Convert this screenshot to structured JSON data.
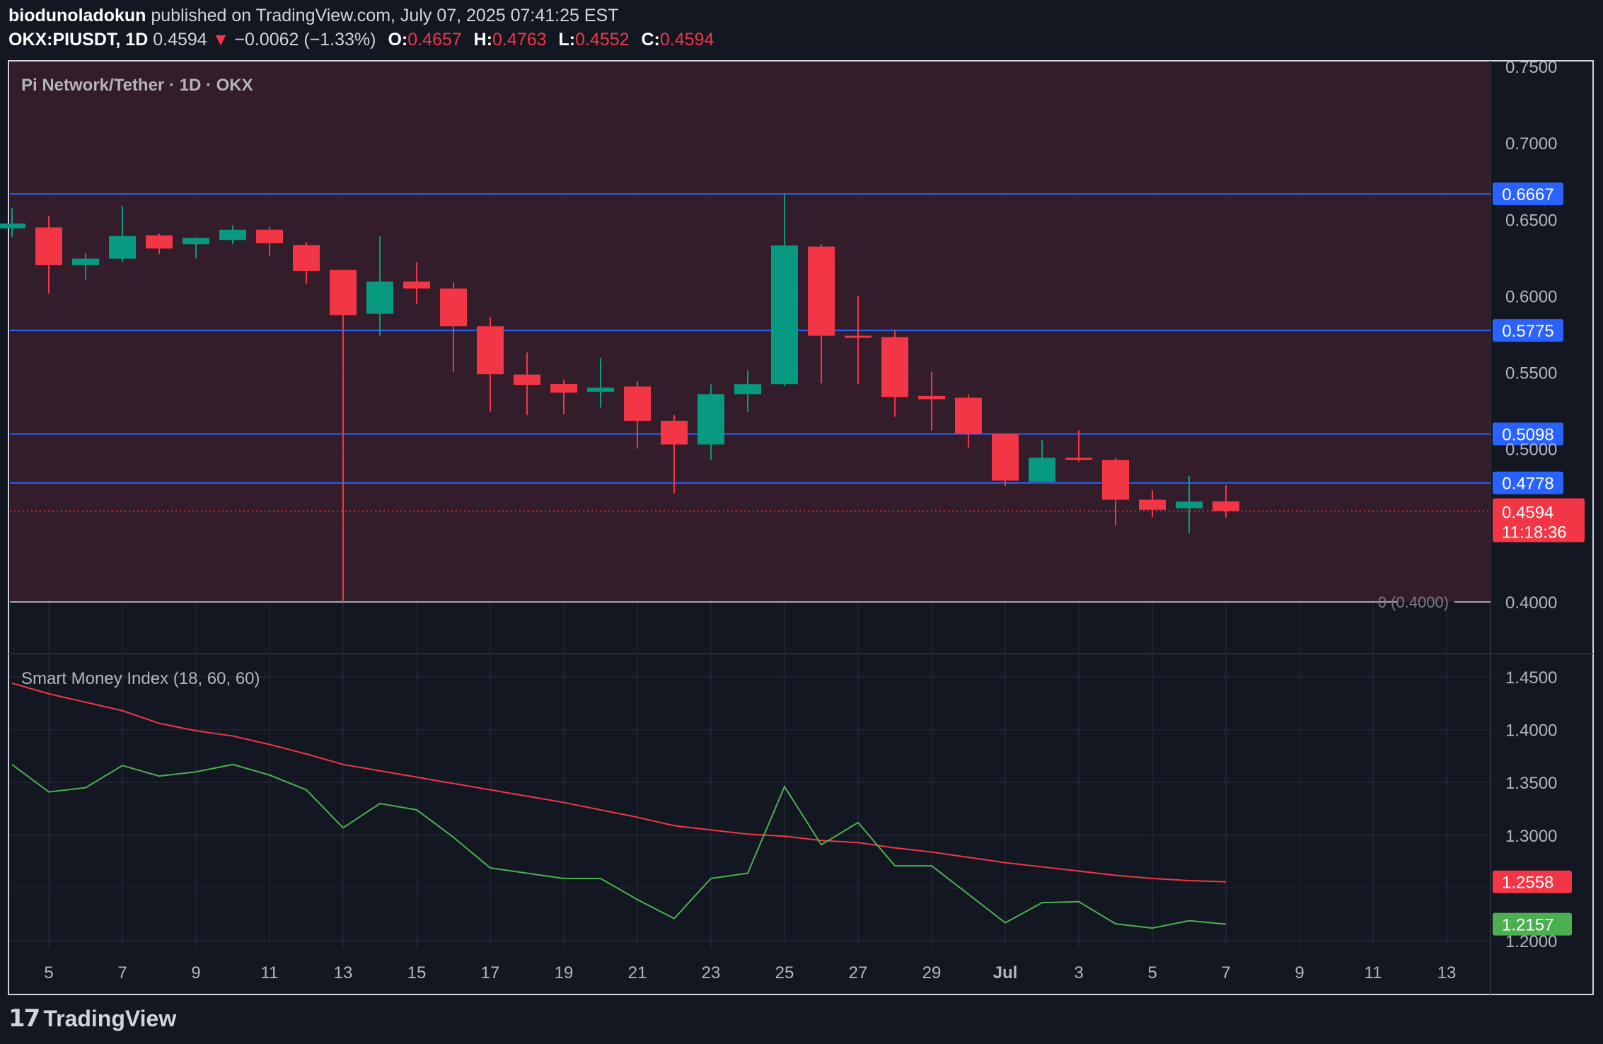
{
  "header": {
    "author": "biodunoladokun",
    "published_text": "published on TradingView.com, July 07, 2025 07:41:25 EST",
    "symbol": "OKX:PIUSDT, 1D",
    "last": "0.4594",
    "change_arrow": "▼",
    "change": "−0.0062 (−1.33%)",
    "open_label": "O:",
    "open": "0.4657",
    "high_label": "H:",
    "high": "0.4763",
    "low_label": "L:",
    "low": "0.4552",
    "close_label": "C:",
    "close": "0.4594"
  },
  "chart_data": [
    {
      "type": "candlestick",
      "title": "Pi Network/Tether · 1D · OKX",
      "ylim": [
        0.4,
        0.75
      ],
      "y_ticks": [
        "0.7500",
        "0.7000",
        "0.6500",
        "0.6000",
        "0.5500",
        "0.5000",
        "0.4000"
      ],
      "x_ticks": [
        "5",
        "7",
        "9",
        "11",
        "13",
        "15",
        "17",
        "19",
        "21",
        "23",
        "25",
        "27",
        "29",
        "Jul",
        "3",
        "5",
        "7",
        "9",
        "11",
        "13"
      ],
      "horizontal_levels": [
        {
          "value": 0.6667,
          "label": "0.6667"
        },
        {
          "value": 0.5775,
          "label": "0.5775"
        },
        {
          "value": 0.5098,
          "label": "0.5098"
        },
        {
          "value": 0.4778,
          "label": "0.4778"
        }
      ],
      "base_level": {
        "value": 0.4,
        "label": "0 (0.4000)"
      },
      "last_price_label": "0.4594",
      "countdown_label": "11:18:36",
      "candles": [
        {
          "date": "Jun 4",
          "open": 0.6442,
          "high": 0.6573,
          "low": 0.6385,
          "close": 0.6473
        },
        {
          "date": "Jun 5",
          "open": 0.6448,
          "high": 0.6521,
          "low": 0.6015,
          "close": 0.6201
        },
        {
          "date": "Jun 6",
          "open": 0.6201,
          "high": 0.6279,
          "low": 0.6107,
          "close": 0.6244
        },
        {
          "date": "Jun 7",
          "open": 0.6244,
          "high": 0.6587,
          "low": 0.6221,
          "close": 0.6392
        },
        {
          "date": "Jun 8",
          "open": 0.6396,
          "high": 0.6407,
          "low": 0.6273,
          "close": 0.631
        },
        {
          "date": "Jun 9",
          "open": 0.6338,
          "high": 0.6384,
          "low": 0.6246,
          "close": 0.6379
        },
        {
          "date": "Jun 10",
          "open": 0.6366,
          "high": 0.6463,
          "low": 0.6338,
          "close": 0.6433
        },
        {
          "date": "Jun 11",
          "open": 0.6433,
          "high": 0.6449,
          "low": 0.6264,
          "close": 0.6345
        },
        {
          "date": "Jun 12",
          "open": 0.6333,
          "high": 0.6353,
          "low": 0.608,
          "close": 0.6164
        },
        {
          "date": "Jun 13",
          "open": 0.617,
          "high": 0.617,
          "low": 0.4,
          "close": 0.5875
        },
        {
          "date": "Jun 14",
          "open": 0.5883,
          "high": 0.6389,
          "low": 0.574,
          "close": 0.6094
        },
        {
          "date": "Jun 15",
          "open": 0.6094,
          "high": 0.6219,
          "low": 0.5948,
          "close": 0.6049
        },
        {
          "date": "Jun 16",
          "open": 0.6049,
          "high": 0.6089,
          "low": 0.5503,
          "close": 0.5802
        },
        {
          "date": "Jun 17",
          "open": 0.5802,
          "high": 0.5862,
          "low": 0.5245,
          "close": 0.5488
        },
        {
          "date": "Jun 18",
          "open": 0.5486,
          "high": 0.563,
          "low": 0.522,
          "close": 0.5419
        },
        {
          "date": "Jun 19",
          "open": 0.5424,
          "high": 0.5454,
          "low": 0.5227,
          "close": 0.5368
        },
        {
          "date": "Jun 20",
          "open": 0.5374,
          "high": 0.5595,
          "low": 0.5268,
          "close": 0.5401
        },
        {
          "date": "Jun 21",
          "open": 0.5408,
          "high": 0.5441,
          "low": 0.5001,
          "close": 0.5184
        },
        {
          "date": "Jun 22",
          "open": 0.5184,
          "high": 0.5221,
          "low": 0.4709,
          "close": 0.5029
        },
        {
          "date": "Jun 23",
          "open": 0.5029,
          "high": 0.5422,
          "low": 0.4927,
          "close": 0.5358
        },
        {
          "date": "Jun 24",
          "open": 0.5358,
          "high": 0.5514,
          "low": 0.5243,
          "close": 0.5423
        },
        {
          "date": "Jun 25",
          "open": 0.5423,
          "high": 0.6667,
          "low": 0.5412,
          "close": 0.633
        },
        {
          "date": "Jun 26",
          "open": 0.6323,
          "high": 0.6338,
          "low": 0.5429,
          "close": 0.574
        },
        {
          "date": "Jun 27",
          "open": 0.574,
          "high": 0.6002,
          "low": 0.5424,
          "close": 0.5731
        },
        {
          "date": "Jun 28",
          "open": 0.5731,
          "high": 0.5775,
          "low": 0.5211,
          "close": 0.534
        },
        {
          "date": "Jun 29",
          "open": 0.5346,
          "high": 0.5504,
          "low": 0.5121,
          "close": 0.5325
        },
        {
          "date": "Jun 30",
          "open": 0.5335,
          "high": 0.5356,
          "low": 0.5009,
          "close": 0.5098
        },
        {
          "date": "Jul 1",
          "open": 0.5098,
          "high": 0.5098,
          "low": 0.4758,
          "close": 0.4793
        },
        {
          "date": "Jul 2",
          "open": 0.4786,
          "high": 0.506,
          "low": 0.4776,
          "close": 0.4943
        },
        {
          "date": "Jul 3",
          "open": 0.4943,
          "high": 0.5122,
          "low": 0.4918,
          "close": 0.4929
        },
        {
          "date": "Jul 4",
          "open": 0.4929,
          "high": 0.4943,
          "low": 0.45,
          "close": 0.4668
        },
        {
          "date": "Jul 5",
          "open": 0.4668,
          "high": 0.4729,
          "low": 0.4555,
          "close": 0.4602
        },
        {
          "date": "Jul 6",
          "open": 0.4612,
          "high": 0.4823,
          "low": 0.445,
          "close": 0.4656
        },
        {
          "date": "Jul 7",
          "open": 0.4657,
          "high": 0.4763,
          "low": 0.4552,
          "close": 0.4594
        }
      ]
    },
    {
      "type": "line",
      "title": "Smart Money Index (18, 60, 60)",
      "ylim": [
        1.195,
        1.455
      ],
      "y_ticks": [
        "1.4500",
        "1.4000",
        "1.3500",
        "1.3000",
        "1.2000"
      ],
      "last_labels": {
        "signal": "1.2558",
        "index": "1.2157"
      },
      "x": [
        "Jun 4",
        "Jun 5",
        "Jun 6",
        "Jun 7",
        "Jun 8",
        "Jun 9",
        "Jun 10",
        "Jun 11",
        "Jun 12",
        "Jun 13",
        "Jun 14",
        "Jun 15",
        "Jun 16",
        "Jun 17",
        "Jun 18",
        "Jun 19",
        "Jun 20",
        "Jun 21",
        "Jun 22",
        "Jun 23",
        "Jun 24",
        "Jun 25",
        "Jun 26",
        "Jun 27",
        "Jun 28",
        "Jun 29",
        "Jun 30",
        "Jul 1",
        "Jul 2",
        "Jul 3",
        "Jul 4",
        "Jul 5",
        "Jul 6",
        "Jul 7"
      ],
      "series": [
        {
          "color": "#f23645",
          "values": [
            1.444,
            1.434,
            1.426,
            1.418,
            1.406,
            1.399,
            1.394,
            1.386,
            1.377,
            1.367,
            1.361,
            1.355,
            1.349,
            1.343,
            1.337,
            1.331,
            1.324,
            1.317,
            1.309,
            1.305,
            1.301,
            1.299,
            1.295,
            1.293,
            1.288,
            1.284,
            1.279,
            1.274,
            1.27,
            1.266,
            1.262,
            1.259,
            1.257,
            1.2558
          ]
        },
        {
          "color": "#4caf50",
          "values": [
            1.367,
            1.341,
            1.345,
            1.366,
            1.356,
            1.36,
            1.367,
            1.357,
            1.343,
            1.307,
            1.33,
            1.324,
            1.298,
            1.269,
            1.264,
            1.259,
            1.259,
            1.239,
            1.221,
            1.259,
            1.264,
            1.346,
            1.291,
            1.312,
            1.271,
            1.271,
            1.244,
            1.217,
            1.236,
            1.237,
            1.216,
            1.212,
            1.219,
            1.2157
          ]
        }
      ]
    }
  ],
  "footer": {
    "brand": "TradingView"
  },
  "colors": {
    "background": "#131722",
    "pane_band": "#3a1f2b",
    "up": "#089981",
    "down": "#f23645",
    "level_line": "#2962ff",
    "grid": "#232632",
    "axis_text": "#b2b5be"
  }
}
